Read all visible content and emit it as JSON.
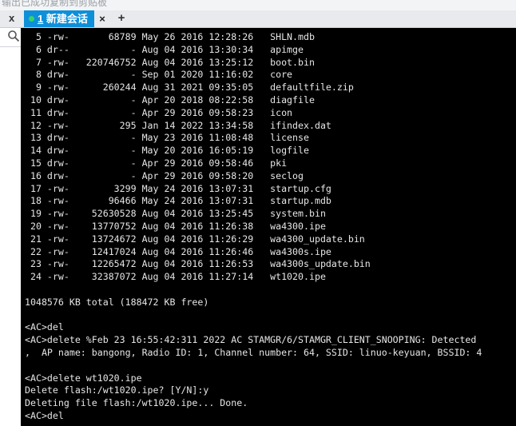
{
  "window": {
    "topstrip_text": "输出已成功复制到剪贴板",
    "tab_label": "1 新建会话",
    "tab_number": "1",
    "tab_title": "新建会话",
    "close_glyph": "×",
    "add_glyph": "+"
  },
  "left_panel": {
    "close_glyph": "x"
  },
  "terminal": {
    "listing_rows": [
      "  5 -rw-       68789 May 26 2016 12:28:26   SHLN.mdb",
      "  6 dr--           - Aug 04 2016 13:30:34   apimge",
      "  7 -rw-   220746752 Aug 04 2016 13:25:12   boot.bin",
      "  8 drw-           - Sep 01 2020 11:16:02   core",
      "  9 -rw-      260244 Aug 31 2021 09:35:05   defaultfile.zip",
      " 10 drw-           - Apr 20 2018 08:22:58   diagfile",
      " 11 drw-           - Apr 29 2016 09:58:23   icon",
      " 12 -rw-         295 Jan 14 2022 13:34:58   ifindex.dat",
      " 13 drw-           - May 23 2016 11:08:48   license",
      " 14 drw-           - May 20 2016 16:05:19   logfile",
      " 15 drw-           - Apr 29 2016 09:58:46   pki",
      " 16 drw-           - Apr 29 2016 09:58:20   seclog",
      " 17 -rw-        3299 May 24 2016 13:07:31   startup.cfg",
      " 18 -rw-       96466 May 24 2016 13:07:31   startup.mdb",
      " 19 -rw-    52630528 Aug 04 2016 13:25:45   system.bin",
      " 20 -rw-    13770752 Aug 04 2016 11:26:38   wa4300.ipe",
      " 21 -rw-    13724672 Aug 04 2016 11:26:29   wa4300_update.bin",
      " 22 -rw-    12417024 Aug 04 2016 11:26:46   wa4300s.ipe",
      " 23 -rw-    12265472 Aug 04 2016 11:26:53   wa4300s_update.bin",
      " 24 -rw-    32387072 Aug 04 2016 11:27:14   wt1020.ipe"
    ],
    "blank_1": "",
    "total_line": "1048576 KB total (188472 KB free)",
    "blank_2": "",
    "cmd_1": "<AC>del",
    "log_line_1": "<AC>delete %Feb 23 16:55:42:311 2022 AC STAMGR/6/STAMGR_CLIENT_SNOOPING: Detected",
    "log_line_2": ",  AP name: bangong, Radio ID: 1, Channel number: 64, SSID: linuo-keyuan, BSSID: 4",
    "blank_3": "",
    "cmd_2": "<AC>delete wt1020.ipe",
    "confirm_line": "Delete flash:/wt1020.ipe? [Y/N]:y",
    "result_line": "Deleting file flash:/wt1020.ipe... Done.",
    "cmd_3": "<AC>del"
  }
}
